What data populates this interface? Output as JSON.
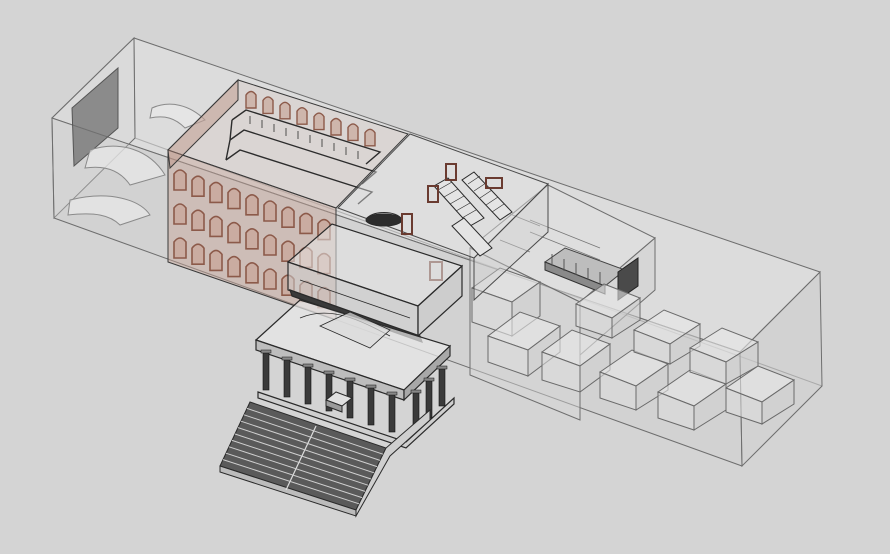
{
  "scene": {
    "kind": "axonometric-architectural-model",
    "colors": {
      "background": "#d4d4d4",
      "glass_fill": "#e6e6e6",
      "edge": "#6e6e6e",
      "dark_edge": "#2c2c2c",
      "facade_brick": "#8c5a4a",
      "arch_inner": "#c9a89b",
      "column": "#3a3a3a",
      "stair_tread": "#505050",
      "panel": "#707070"
    },
    "elements": [
      "outer-glass-volume",
      "arched-facade-block",
      "central-stair-hall",
      "portico-temple",
      "front-grand-stairs",
      "gallery-volume",
      "display-boxes"
    ]
  }
}
